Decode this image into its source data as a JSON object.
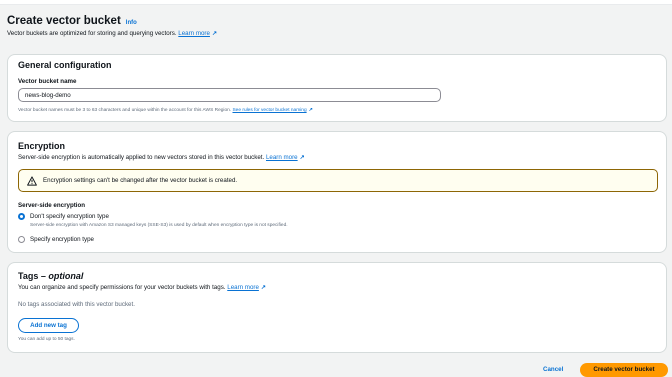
{
  "header": {
    "title": "Create vector bucket",
    "info": "Info",
    "description": "Vector buckets are optimized for storing and querying vectors.",
    "learn_more": "Learn more"
  },
  "general": {
    "title": "General configuration",
    "field_label": "Vector bucket name",
    "field_value": "news-blog-demo",
    "hint": "Vector bucket names must be 3 to 63 characters and unique within the account for this AWS Region.",
    "hint_link": "See rules for vector bucket naming"
  },
  "encryption": {
    "title": "Encryption",
    "description": "Server-side encryption is automatically applied to new vectors stored in this vector bucket.",
    "learn_more": "Learn more",
    "alert": "Encryption settings can't be changed after the vector bucket is created.",
    "sse_label": "Server-side encryption",
    "options": [
      {
        "label": "Don't specify encryption type",
        "sub": "Server-side encryption with Amazon S3 managed keys (SSE-S3) is used by default when encryption type is not specified.",
        "selected": true
      },
      {
        "label": "Specify encryption type",
        "selected": false
      }
    ]
  },
  "tags": {
    "title": "Tags",
    "title_optional": "optional",
    "description": "You can organize and specify permissions for your vector buckets with tags.",
    "learn_more": "Learn more",
    "empty": "No tags associated with this vector bucket.",
    "add_button": "Add new tag",
    "limit": "You can add up to 50 tags."
  },
  "footer": {
    "cancel": "Cancel",
    "create": "Create vector bucket"
  },
  "colors": {
    "link": "#0972d3",
    "primary": "#ff9900",
    "warning": "#8d6605"
  }
}
